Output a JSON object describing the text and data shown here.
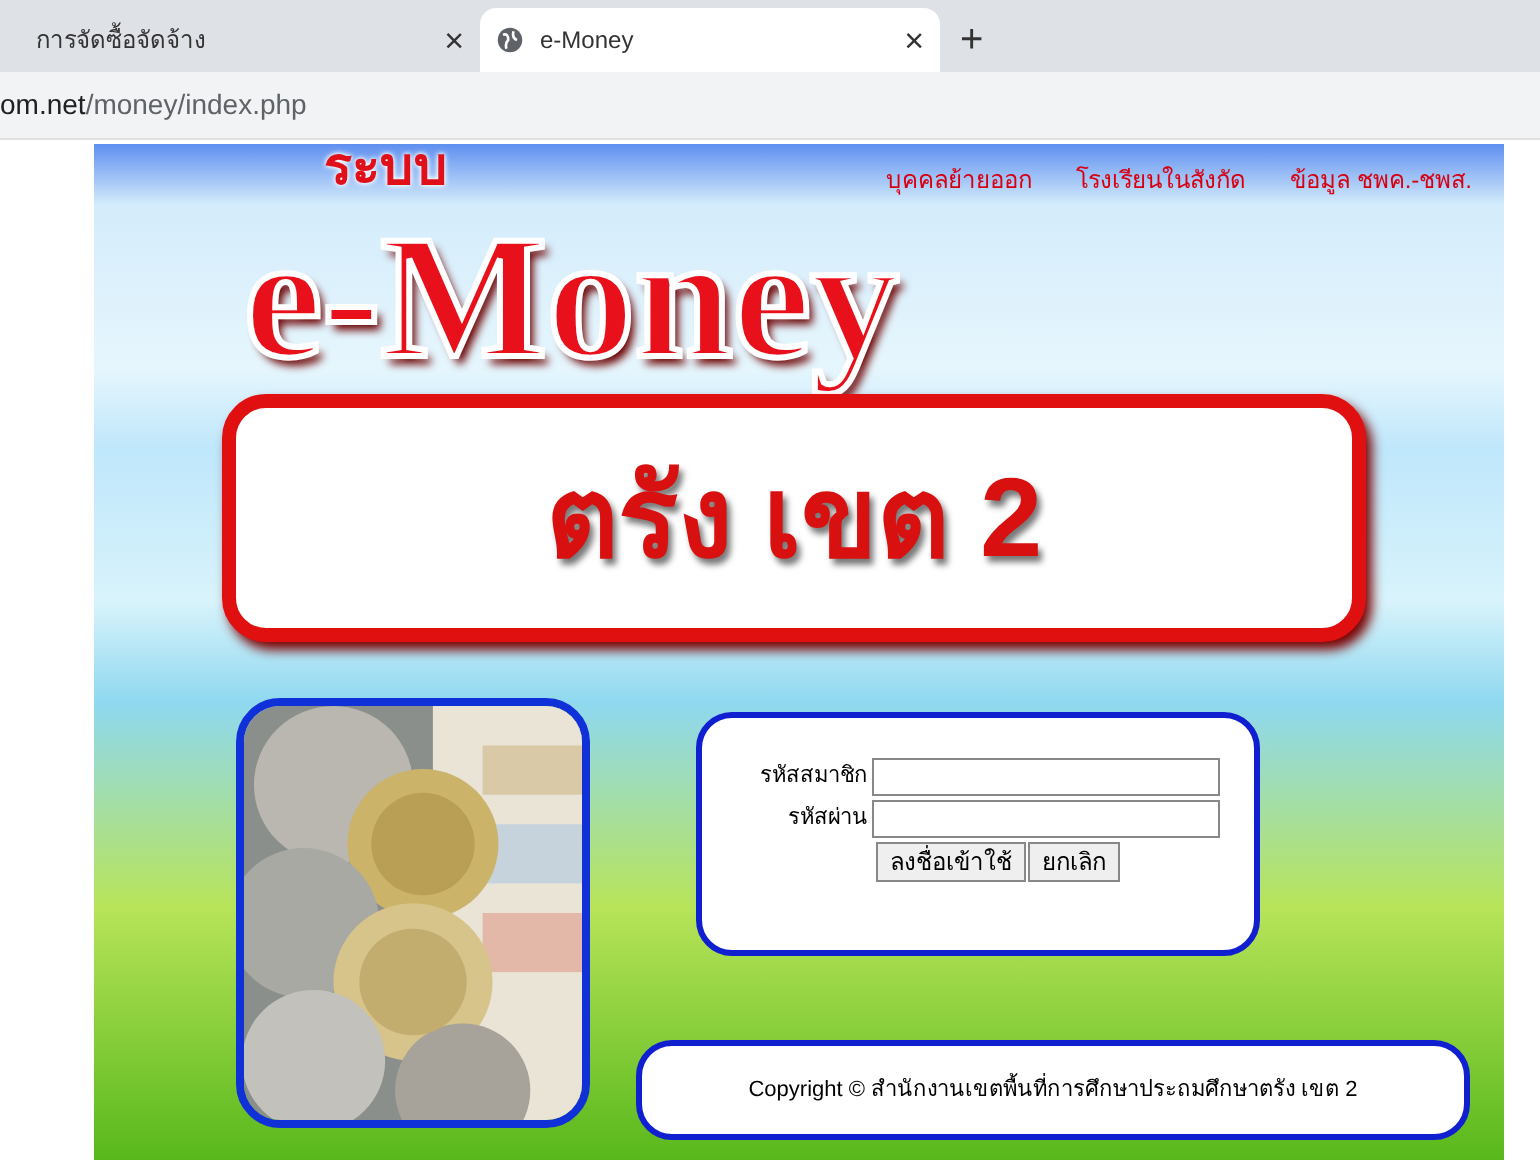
{
  "browser": {
    "tabs": [
      {
        "title": "การจัดซื้อจัดจ้าง",
        "selected": false,
        "close": "×"
      },
      {
        "title": "e-Money",
        "selected": true,
        "close": "×"
      }
    ],
    "new_tab": "+",
    "url": {
      "host": "om.net",
      "path": "/money/index.php"
    }
  },
  "nav_links": [
    "บุคคลย้ายออก",
    "โรงเรียนในสังกัด",
    "ข้อมูล ชพค.-ชพส."
  ],
  "banner": {
    "system_label": "ระบบ",
    "title": "e-Money",
    "subtitle": "ตรัง เขต 2"
  },
  "login": {
    "fields": [
      {
        "label": "รหัสสมาชิก"
      },
      {
        "label": "รหัสผ่าน"
      }
    ],
    "buttons": [
      "ลงชื่อเข้าใช้",
      "ยกเลิก"
    ]
  },
  "footer": "Copyright © สำนักงานเขตพื้นที่การศึกษาประถมศึกษาตรัง เขต 2"
}
